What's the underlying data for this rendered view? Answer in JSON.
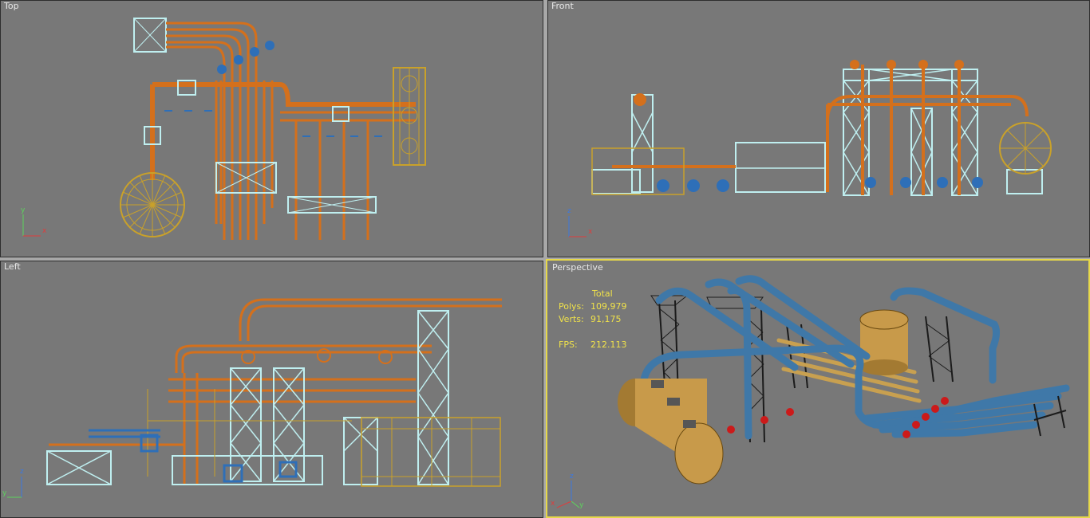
{
  "viewports": {
    "top": {
      "label": "Top",
      "axes": [
        "y",
        "x"
      ]
    },
    "front": {
      "label": "Front",
      "axes": [
        "z",
        "x"
      ]
    },
    "left": {
      "label": "Left",
      "axes": [
        "z",
        "y"
      ]
    },
    "perspective": {
      "label": "Perspective",
      "axes": [
        "z",
        "x",
        "y"
      ]
    }
  },
  "stats": {
    "header": "Total",
    "polys_label": "Polys:",
    "polys_value": "109,979",
    "verts_label": "Verts:",
    "verts_value": "91,175",
    "fps_label": "FPS:",
    "fps_value": "212.113"
  },
  "colors": {
    "viewport_bg": "#787878",
    "pipe_orange": "#d4701c",
    "frame_cyan": "#bfeff0",
    "tank_yellow": "#c9a12a",
    "flange_blue": "#2e6fb8",
    "pipe_blue": "#3f78a8",
    "tank_tan": "#c89a4a",
    "valve_red": "#cc1a1a",
    "active_border": "#e6d84a",
    "label_text": "#e8e8e8",
    "stats_text": "#f0e24a"
  }
}
